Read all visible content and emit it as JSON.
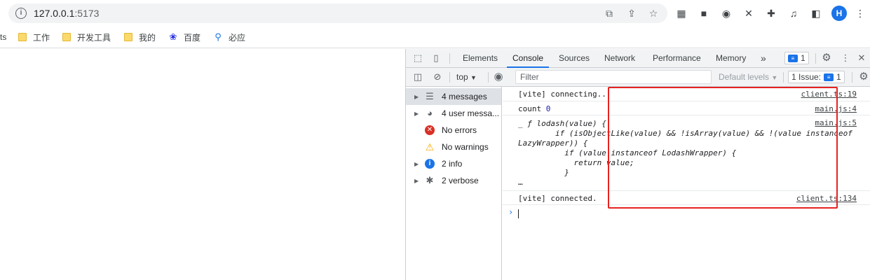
{
  "browser": {
    "url_host": "127.0.0.1",
    "url_port": ":5173",
    "avatar_letter": "H"
  },
  "bookmarks": [
    {
      "label": "ts",
      "icon": "cut-off"
    },
    {
      "label": "工作",
      "icon": "folder-icon"
    },
    {
      "label": "开发工具",
      "icon": "folder-icon"
    },
    {
      "label": "我的",
      "icon": "folder-icon"
    },
    {
      "label": "百度",
      "icon": "baidu-paw-icon"
    },
    {
      "label": "必应",
      "icon": "bing-search-icon"
    }
  ],
  "devtools": {
    "tabs": [
      "Elements",
      "Console",
      "Sources",
      "Network",
      "Performance",
      "Memory"
    ],
    "active_tab": "Console",
    "more_tabs_glyph": "»",
    "message_badge_count": "1",
    "toolbar": {
      "context": "top",
      "filter_placeholder": "Filter",
      "levels": "Default levels",
      "issues_label": "1 Issue:",
      "issues_count": "1"
    },
    "sidebar": [
      {
        "label": "4 messages",
        "icon": "list-icon",
        "expandable": true,
        "selected": true
      },
      {
        "label": "4 user messa...",
        "icon": "user-icon",
        "expandable": true,
        "selected": false
      },
      {
        "label": "No errors",
        "icon": "error-icon",
        "expandable": false,
        "selected": false
      },
      {
        "label": "No warnings",
        "icon": "warning-icon",
        "expandable": false,
        "selected": false
      },
      {
        "label": "2 info",
        "icon": "info-icon",
        "expandable": true,
        "selected": false
      },
      {
        "label": "2 verbose",
        "icon": "bug-icon",
        "expandable": true,
        "selected": false
      }
    ],
    "console": {
      "messages": [
        {
          "text": "[vite] connecting...",
          "source": "client.ts:19"
        },
        {
          "text_prefix": "count ",
          "text_number": "0",
          "source": "main.js:4"
        },
        {
          "lines": [
            "_ ƒ lodash(value) {",
            "        if (isObjectLike(value) && !isArray(value) && !(value instanceof",
            "LazyWrapper)) {",
            "          if (value instanceof LodashWrapper) {",
            "            return value;",
            "          }",
            "…"
          ],
          "source": "main.js:5"
        },
        {
          "text": "[vite] connected.",
          "source": "client.ts:134"
        }
      ],
      "prompt_glyph": "›"
    }
  },
  "colors": {
    "highlight_box": "#e52320",
    "accent": "#1a73e8"
  }
}
